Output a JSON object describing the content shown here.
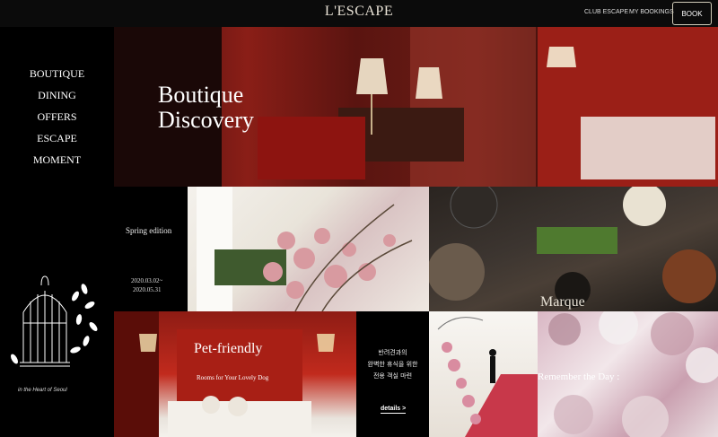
{
  "header": {
    "logo": "L'ESCAPE",
    "links": [
      "CLUB ESCAPE",
      "MY BOOKINGS"
    ],
    "book_label": "BOOK"
  },
  "sidebar": {
    "items": [
      {
        "label": "BOUTIQUE"
      },
      {
        "label": "DINING"
      },
      {
        "label": "OFFERS"
      },
      {
        "label": "ESCAPE"
      },
      {
        "label": "MOMENT"
      }
    ],
    "tagline": "in the Heart of Seoul"
  },
  "hero": {
    "title_line1": "Boutique",
    "title_line2": "Discovery"
  },
  "spring": {
    "title": "Spring edition",
    "date_start": "2020.03.02~",
    "date_end": "2020.05.31"
  },
  "dining": {
    "label": "Marque"
  },
  "pet": {
    "title": "Pet-friendly",
    "subtitle": "Rooms for Your Lovely Dog",
    "desc_line1": "반려견과의",
    "desc_line2": "완벽한 휴식을 위한",
    "desc_line3": "전용 객실 마련",
    "details_label": "details >"
  },
  "wedding": {
    "title": "Remember the Day :"
  }
}
